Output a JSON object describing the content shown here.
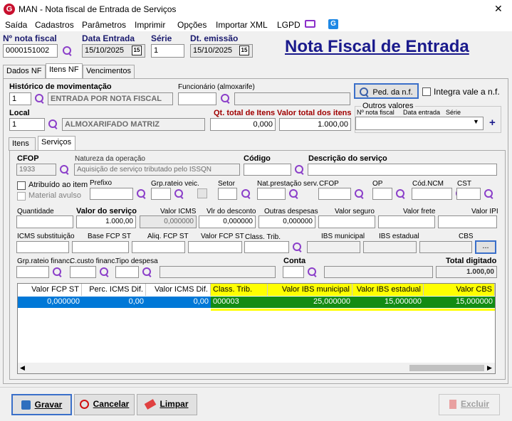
{
  "window": {
    "title": "MAN - Nota fiscal de Entrada de Serviços",
    "logo": "G"
  },
  "menu": [
    "Saída",
    "Cadastros",
    "Parâmetros",
    "Imprimir",
    "Opções",
    "Importar XML",
    "LGPD"
  ],
  "header": {
    "nf_label": "Nº nota fiscal",
    "nf_value": "0000151002",
    "data_entrada_label": "Data Entrada",
    "data_entrada_value": "15/10/2025",
    "serie_label": "Série",
    "serie_value": "1",
    "dt_emissao_label": "Dt. emissão",
    "dt_emissao_value": "15/10/2025",
    "big_title": "Nota Fiscal de Entrada",
    "cal_text": "15"
  },
  "tabs": [
    "Dados NF",
    "Itens NF",
    "Vencimentos"
  ],
  "itens": {
    "historico_label": "Histórico de movimentação",
    "historico_code": "1",
    "historico_desc": "ENTRADA POR NOTA FISCAL",
    "funcionario_label": "Funcionário (almoxarife)",
    "funcionario_value": "",
    "ped_button": "Ped. da n.f.",
    "integra_label": "Integra vale a n.f.",
    "local_label": "Local",
    "local_code": "1",
    "local_desc": "ALMOXARIFADO MATRIZ",
    "qt_total_label": "Qt. total de Itens",
    "qt_total_value": "0,000",
    "valor_total_label": "Valor total dos itens",
    "valor_total_value": "1.000,00",
    "outros_label": "Outros valores",
    "outros_cols": [
      "Nº nota fiscal",
      "Data entrada",
      "Série"
    ],
    "plus": "+"
  },
  "subtabs": [
    "Itens",
    "Serviços"
  ],
  "servicos": {
    "cfop_label": "CFOP",
    "cfop_value": "1933",
    "natureza_label": "Natureza da operação",
    "natureza_value": "Aquisição de serviço tributado pelo ISSQN",
    "codigo_label": "Código",
    "codigo_value": "",
    "descricao_label": "Descrição do serviço",
    "descricao_value": "",
    "atribuido_label": "Atribuído ao item",
    "material_label": "Material avulso",
    "prefixo_label": "Prefixo",
    "grp_rateio_veic_label": "Grp.rateio veic.",
    "setor_label": "Setor",
    "nat_prest_label": "Nat.prestação serv.",
    "cfop2_label": "CFOP",
    "op_label": "OP",
    "cod_ncm_label": "Cód.NCM",
    "cst_label": "CST",
    "quantidade_label": "Quantidade",
    "quantidade_value": "",
    "valor_servico_label": "Valor do serviço",
    "valor_servico_value": "1.000,00",
    "valor_icms_label": "Valor ICMS",
    "valor_icms_value": "0,000000",
    "vlr_desconto_label": "Vlr do desconto",
    "vlr_desconto_value": "0,000000",
    "outras_despesas_label": "Outras despesas",
    "outras_despesas_value": "0,000000",
    "valor_seguro_label": "Valor seguro",
    "valor_frete_label": "Valor frete",
    "valor_ipi_label": "Valor IPI",
    "icms_st_label": "ICMS substituição",
    "base_fcp_label": "Base FCP ST",
    "aliq_fcp_label": "Aliq. FCP ST",
    "valor_fcp_label": "Valor FCP ST",
    "class_trib_label": "Class. Trib.",
    "ibs_mun_label": "IBS municipal",
    "ibs_est_label": "IBS estadual",
    "cbs_label": "CBS",
    "dots_button": "...",
    "grp_rateio_fin_label": "Grp.rateio financ.",
    "c_custo_label": "C.custo financ.",
    "tipo_despesa_label": "Tipo despesa",
    "conta_label": "Conta",
    "total_digitado_label": "Total digitado",
    "total_digitado_value": "1.000,00"
  },
  "grid": {
    "headers": [
      "Valor FCP ST",
      "Perc. ICMS Dif.",
      "Valor ICMS Dif.",
      "Class. Trib.",
      "Valor IBS municipal",
      "Valor IBS estadual",
      "Valor CBS"
    ],
    "row": [
      "0,000000",
      "0,00",
      "0,00",
      "000003",
      "25,000000",
      "15,000000",
      "15,000000"
    ]
  },
  "buttons": {
    "gravar": "Gravar",
    "cancelar": "Cancelar",
    "limpar": "Limpar",
    "excluir": "Excluir"
  }
}
